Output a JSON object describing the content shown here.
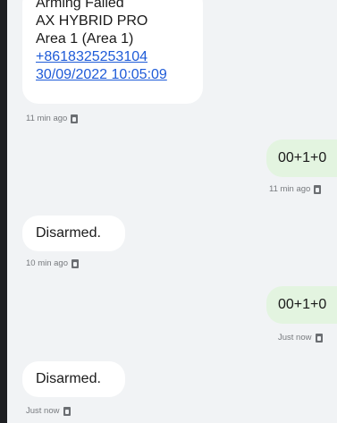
{
  "conversation": {
    "messages": [
      {
        "direction": "incoming",
        "lines": [
          "Arming Failed",
          "AX HYBRID PRO",
          "Area 1 (Area 1)"
        ],
        "phone": "+8618325253104",
        "datetime": "30/09/2022 10:05:09",
        "time_label": "11 min ago",
        "sim_label": "1"
      },
      {
        "direction": "outgoing",
        "text": "00+1+0",
        "time_label": "11 min ago",
        "sim_label": "1"
      },
      {
        "direction": "incoming",
        "text": "Disarmed.",
        "time_label": "10 min ago",
        "sim_label": "1"
      },
      {
        "direction": "outgoing",
        "text": "00+1+0",
        "time_label": "Just now",
        "sim_label": "1"
      },
      {
        "direction": "incoming",
        "text": "Disarmed.",
        "time_label": "Just now",
        "sim_label": "1"
      }
    ]
  },
  "colors": {
    "background": "#1d1f22",
    "chat_background": "#f1f3f5",
    "incoming_bubble": "#ffffff",
    "outgoing_bubble": "#e3f4e0",
    "link": "#1e5bd8"
  }
}
